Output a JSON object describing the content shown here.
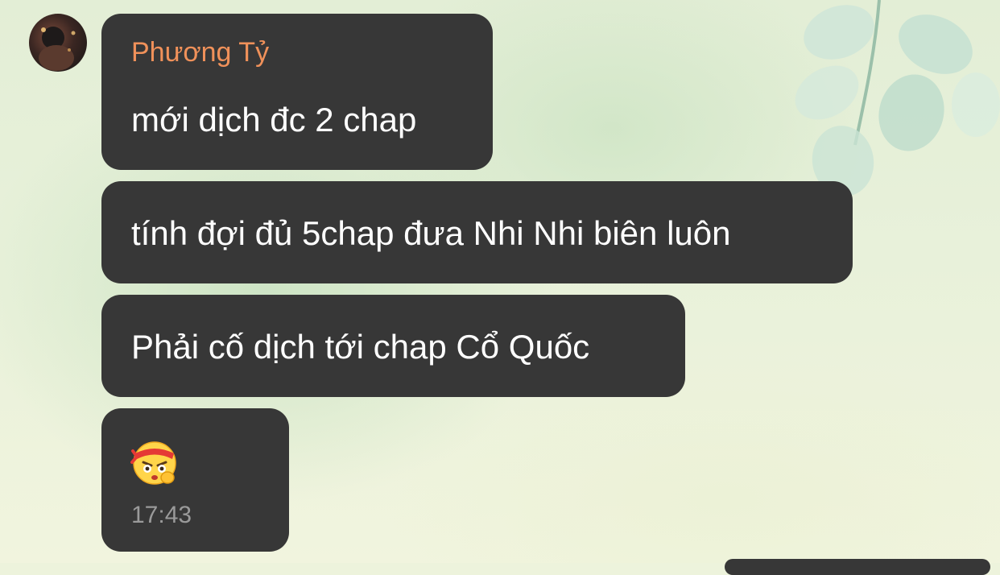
{
  "chat": {
    "sender_name": "Phương Tỷ",
    "messages": [
      {
        "text": "mới dịch đc 2 chap"
      },
      {
        "text": "tính đợi đủ 5chap đưa Nhi Nhi biên luôn"
      },
      {
        "text": "Phải cố dịch tới chap Cổ Quốc"
      },
      {
        "sticker": "angry-headband-emoji",
        "time": "17:43"
      }
    ]
  },
  "colors": {
    "bubble": "#373737",
    "sender_name": "#f0915a",
    "timestamp": "#9a9a9a",
    "message_text": "#ffffff"
  }
}
